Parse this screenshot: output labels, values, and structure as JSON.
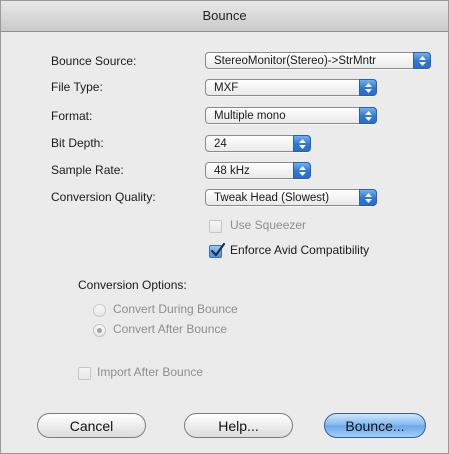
{
  "window": {
    "title": "Bounce"
  },
  "fields": {
    "bounce_source": {
      "label": "Bounce Source:",
      "value": "StereoMonitor(Stereo)->StrMntr"
    },
    "file_type": {
      "label": "File Type:",
      "value": "MXF"
    },
    "format": {
      "label": "Format:",
      "value": "Multiple mono"
    },
    "bit_depth": {
      "label": "Bit Depth:",
      "value": "24"
    },
    "sample_rate": {
      "label": "Sample Rate:",
      "value": "48 kHz"
    },
    "conversion_quality": {
      "label": "Conversion Quality:",
      "value": "Tweak Head (Slowest)"
    }
  },
  "checkboxes": {
    "use_squeezer": {
      "label": "Use Squeezer",
      "checked": false,
      "enabled": false
    },
    "enforce_avid": {
      "label": "Enforce Avid Compatibility",
      "checked": true,
      "enabled": true
    },
    "import_after_bounce": {
      "label": "Import After Bounce",
      "checked": false,
      "enabled": false
    }
  },
  "conversion_options": {
    "label": "Conversion Options:",
    "options": [
      {
        "label": "Convert During Bounce",
        "selected": false,
        "enabled": false
      },
      {
        "label": "Convert After Bounce",
        "selected": true,
        "enabled": false
      }
    ]
  },
  "buttons": {
    "cancel": "Cancel",
    "help": "Help...",
    "bounce": "Bounce..."
  },
  "colors": {
    "accent": "#2e76d6",
    "default_button": "#7fb7ee"
  }
}
